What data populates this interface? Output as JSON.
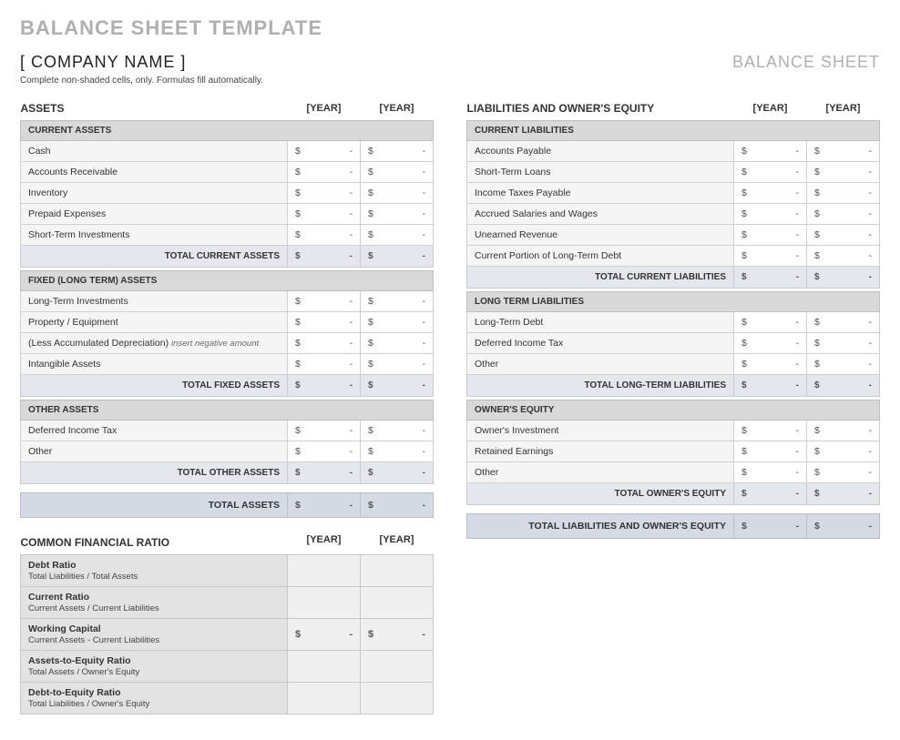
{
  "title": "BALANCE SHEET TEMPLATE",
  "company": "[ COMPANY NAME ]",
  "sheetLabel": "BALANCE SHEET",
  "instructions": "Complete non-shaded cells, only. Formulas fill automatically.",
  "yearHeader1": "[YEAR]",
  "yearHeader2": "[YEAR]",
  "currency": "$",
  "dash": "-",
  "assets": {
    "heading": "ASSETS",
    "current": {
      "label": "CURRENT ASSETS",
      "rows": [
        {
          "label": "Cash"
        },
        {
          "label": "Accounts Receivable"
        },
        {
          "label": "Inventory"
        },
        {
          "label": "Prepaid Expenses"
        },
        {
          "label": "Short-Term Investments"
        }
      ],
      "total": "TOTAL CURRENT ASSETS"
    },
    "fixed": {
      "label": "FIXED (LONG TERM) ASSETS",
      "rows": [
        {
          "label": "Long-Term Investments"
        },
        {
          "label": "Property / Equipment"
        },
        {
          "label": "(Less Accumulated Depreciation)",
          "hint": "insert negative amount"
        },
        {
          "label": "Intangible Assets"
        }
      ],
      "total": "TOTAL FIXED ASSETS"
    },
    "other": {
      "label": "OTHER ASSETS",
      "rows": [
        {
          "label": "Deferred Income Tax"
        },
        {
          "label": "Other"
        }
      ],
      "total": "TOTAL OTHER ASSETS"
    },
    "grandTotal": "TOTAL ASSETS"
  },
  "liab": {
    "heading": "LIABILITIES AND OWNER'S EQUITY",
    "current": {
      "label": "CURRENT LIABILITIES",
      "rows": [
        {
          "label": "Accounts Payable"
        },
        {
          "label": "Short-Term Loans"
        },
        {
          "label": "Income Taxes Payable"
        },
        {
          "label": "Accrued Salaries and Wages"
        },
        {
          "label": "Unearned Revenue"
        },
        {
          "label": "Current Portion of Long-Term Debt"
        }
      ],
      "total": "TOTAL CURRENT LIABILITIES"
    },
    "longterm": {
      "label": "LONG TERM LIABILITIES",
      "rows": [
        {
          "label": "Long-Term Debt"
        },
        {
          "label": "Deferred Income Tax"
        },
        {
          "label": "Other"
        }
      ],
      "total": "TOTAL LONG-TERM LIABILITIES"
    },
    "equity": {
      "label": "OWNER'S EQUITY",
      "rows": [
        {
          "label": "Owner's Investment"
        },
        {
          "label": "Retained Earnings"
        },
        {
          "label": "Other"
        }
      ],
      "total": "TOTAL OWNER'S EQUITY"
    },
    "grandTotal": "TOTAL LIABILITIES AND OWNER'S EQUITY"
  },
  "ratios": {
    "heading": "COMMON FINANCIAL RATIO",
    "rows": [
      {
        "name": "Debt Ratio",
        "desc": "Total Liabilities / Total Assets",
        "showVal": false
      },
      {
        "name": "Current Ratio",
        "desc": "Current Assets / Current Liabilities",
        "showVal": false
      },
      {
        "name": "Working Capital",
        "desc": "Current Assets - Current Liabilities",
        "showVal": true
      },
      {
        "name": "Assets-to-Equity Ratio",
        "desc": "Total Assets / Owner's Equity",
        "showVal": false
      },
      {
        "name": "Debt-to-Equity Ratio",
        "desc": "Total Liabilities / Owner's Equity",
        "showVal": false
      }
    ]
  }
}
